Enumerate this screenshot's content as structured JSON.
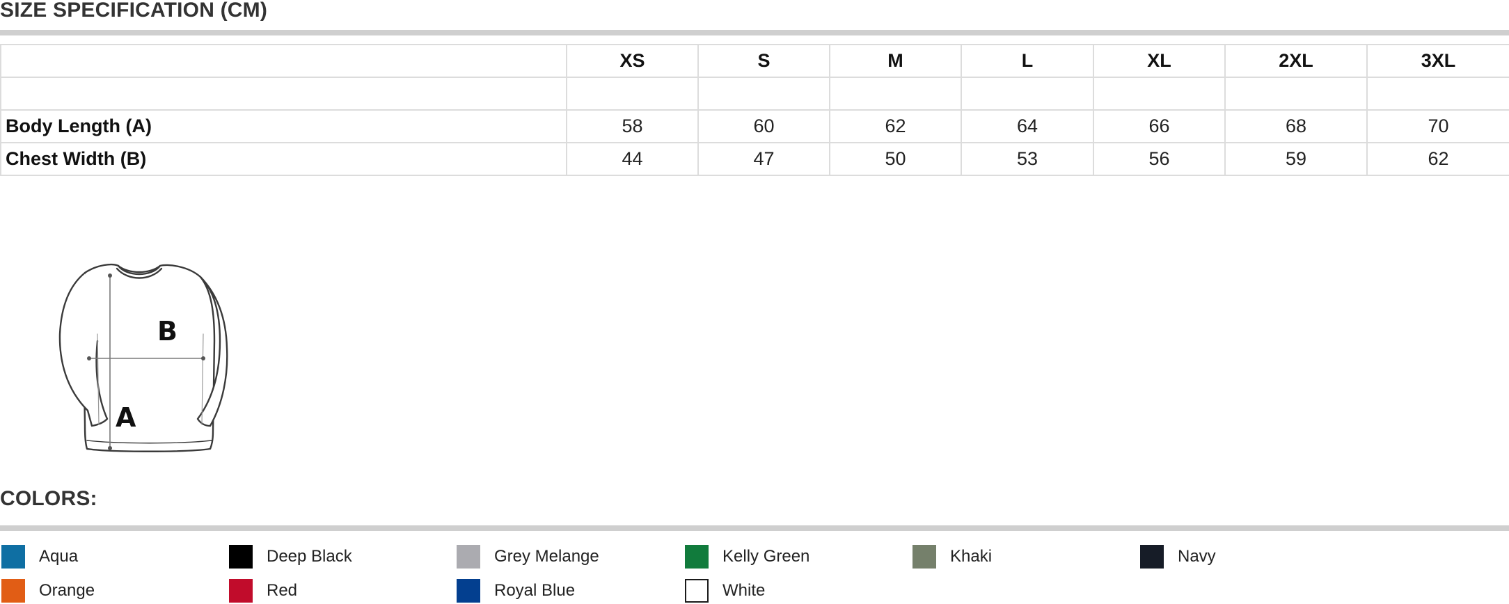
{
  "size_spec": {
    "title": "SIZE SPECIFICATION (CM)",
    "sizes": [
      "XS",
      "S",
      "M",
      "L",
      "XL",
      "2XL",
      "3XL"
    ],
    "rows": [
      {
        "label": "Body Length (A)",
        "values": [
          "58",
          "60",
          "62",
          "64",
          "66",
          "68",
          "70"
        ]
      },
      {
        "label": "Chest Width (B)",
        "values": [
          "44",
          "47",
          "50",
          "53",
          "56",
          "59",
          "62"
        ]
      }
    ]
  },
  "diagram": {
    "label_a": "A",
    "label_b": "B",
    "icon": "longsleeve-tshirt-icon"
  },
  "colors": {
    "title": "COLORS:",
    "items": [
      {
        "name": "Aqua",
        "hex": "#0f6fa3"
      },
      {
        "name": "Deep Black",
        "hex": "#000000"
      },
      {
        "name": "Grey Melange",
        "hex": "#ababb0"
      },
      {
        "name": "Kelly Green",
        "hex": "#117b3c"
      },
      {
        "name": "Khaki",
        "hex": "#75806b"
      },
      {
        "name": "Navy",
        "hex": "#161c27"
      },
      {
        "name": "Orange",
        "hex": "#e15d15"
      },
      {
        "name": "Red",
        "hex": "#c10c2b"
      },
      {
        "name": "Royal Blue",
        "hex": "#033f8f"
      },
      {
        "name": "White",
        "hex": "#ffffff"
      }
    ]
  }
}
